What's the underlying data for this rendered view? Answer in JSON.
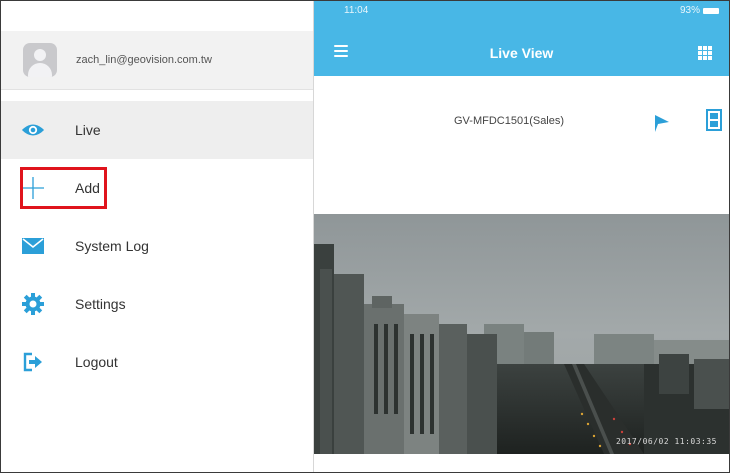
{
  "sidebar": {
    "user_email": "zach_lin@geovision.com.tw",
    "items": [
      {
        "label": "Live",
        "icon": "eye-icon",
        "active": true
      },
      {
        "label": "Add",
        "icon": "plus-icon",
        "highlighted": true
      },
      {
        "label": "System Log",
        "icon": "envelope-icon"
      },
      {
        "label": "Settings",
        "icon": "gear-icon"
      },
      {
        "label": "Logout",
        "icon": "logout-icon"
      }
    ],
    "icon_color": "#2b9fd8",
    "highlight_color": "#e0141c"
  },
  "app": {
    "status_time": "11:04",
    "battery": "93%",
    "title": "Live View",
    "camera_name": "GV-MFDC1501(Sales)",
    "video_timestamp": "2017/06/02   11:03:35",
    "accent_color": "#48b7e6"
  }
}
